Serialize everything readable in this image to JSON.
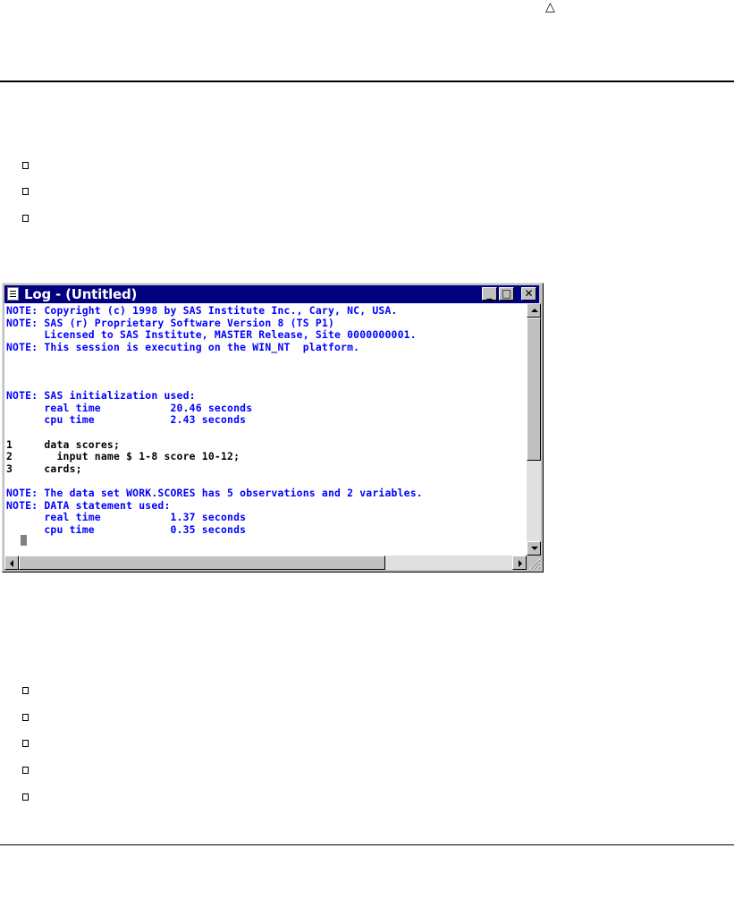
{
  "page": {
    "header_symbol": "△"
  },
  "window": {
    "title": "Log - (Untitled)",
    "buttons": {
      "minimize": "_",
      "maximize": "□",
      "close": "✕"
    },
    "colors": {
      "titlebar": "#000080",
      "note_text": "#0000ff",
      "code_text": "#000000"
    },
    "log_lines": [
      "NOTE: Copyright (c) 1998 by SAS Institute Inc., Cary, NC, USA.",
      "NOTE: SAS (r) Proprietary Software Version 8 (TS P1)",
      "      Licensed to SAS Institute, MASTER Release, Site 0000000001.",
      "NOTE: This session is executing on the WIN_NT  platform.",
      "",
      "",
      "",
      "NOTE: SAS initialization used:",
      "      real time           20.46 seconds",
      "      cpu time            2.43 seconds",
      "",
      "1     data scores;",
      "2       input name $ 1-8 score 10-12;",
      "3     cards;",
      "",
      "NOTE: The data set WORK.SCORES has 5 observations and 2 variables.",
      "NOTE: DATA statement used:",
      "      real time           1.37 seconds",
      "      cpu time            0.35 seconds"
    ]
  }
}
